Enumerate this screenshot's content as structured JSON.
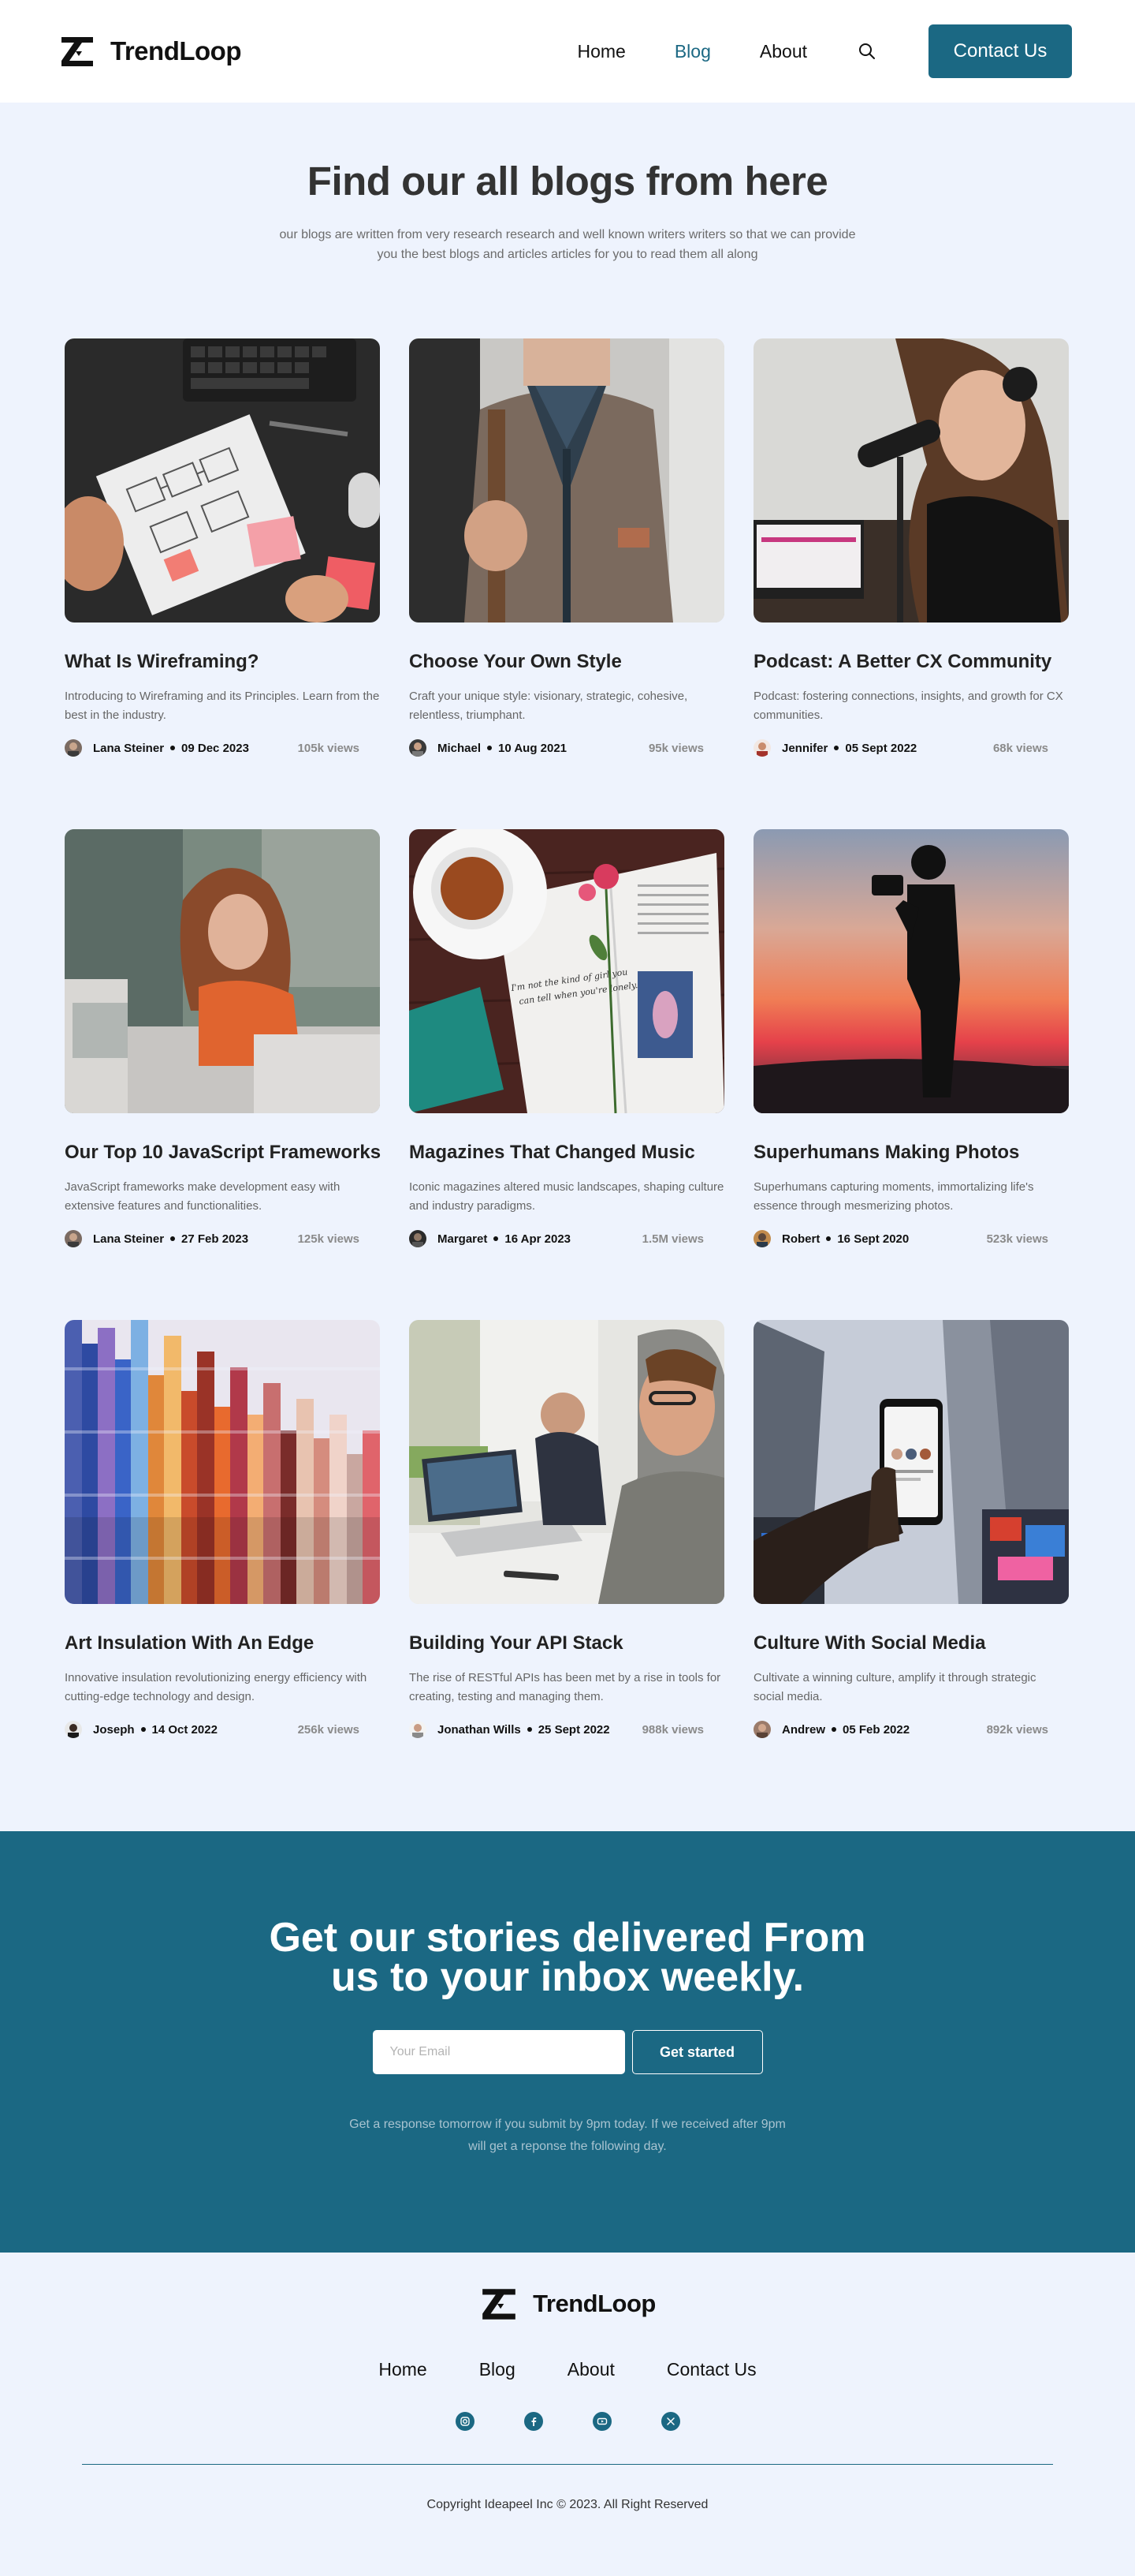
{
  "header": {
    "brand": "TrendLoop",
    "nav": [
      "Home",
      "Blog",
      "About"
    ],
    "active_nav": "Blog",
    "search_icon": "search-icon",
    "contact_label": "Contact Us"
  },
  "hero": {
    "title": "Find our all blogs from here",
    "subtitle": "our blogs are written from very research research and well known writers writers so that  we can provide you the best blogs and articles articles for you to read them all along"
  },
  "posts": [
    {
      "title": "What Is Wireframing?",
      "desc": "Introducing to Wireframing and its Principles. Learn from the best in the industry.",
      "author": "Lana Steiner",
      "date": "09 Dec 2023",
      "views": "105k views"
    },
    {
      "title": "Choose Your Own Style",
      "desc": "Craft your unique style: visionary, strategic, cohesive, relentless, triumphant.",
      "author": "Michael",
      "date": "10 Aug 2021",
      "views": "95k views"
    },
    {
      "title": "Podcast: A Better CX Community",
      "desc": "Podcast: fostering connections, insights, and growth for CX communities.",
      "author": "Jennifer",
      "date": "05 Sept 2022",
      "views": "68k views"
    },
    {
      "title": "Our Top 10 JavaScript Frameworks",
      "desc": "JavaScript frameworks make development easy with extensive features and functionalities.",
      "author": "Lana Steiner",
      "date": "27 Feb 2023",
      "views": "125k views"
    },
    {
      "title": "Magazines That Changed Music",
      "desc": "Iconic magazines altered music landscapes, shaping culture and industry paradigms.",
      "author": "Margaret",
      "date": "16 Apr 2023",
      "views": "1.5M views"
    },
    {
      "title": "Superhumans Making Photos",
      "desc": "Superhumans capturing moments, immortalizing life's essence through mesmerizing photos.",
      "author": "Robert",
      "date": "16 Sept 2020",
      "views": "523k views"
    },
    {
      "title": "Art Insulation With An Edge",
      "desc": "Innovative insulation revolutionizing energy efficiency with cutting-edge technology and design.",
      "author": "Joseph",
      "date": "14 Oct 2022",
      "views": "256k views"
    },
    {
      "title": "Building Your API Stack",
      "desc": "The rise of RESTful APIs has been met by a rise in tools for creating, testing and managing them.",
      "author": "Jonathan Wills",
      "date": "25 Sept 2022",
      "views": "988k views"
    },
    {
      "title": "Culture With Social Media",
      "desc": "Cultivate a winning culture, amplify it through strategic social media.",
      "author": "Andrew",
      "date": "05 Feb 2022",
      "views": "892k views"
    }
  ],
  "newsletter": {
    "title": "Get our stories delivered From us to your inbox weekly.",
    "email_placeholder": "Your Email",
    "button_label": "Get started",
    "note": "Get a response tomorrow if you submit by 9pm today. If we received after 9pm will get a reponse the following day."
  },
  "footer": {
    "brand": "TrendLoop",
    "nav": [
      "Home",
      "Blog",
      "About",
      "Contact Us"
    ],
    "socials": [
      "instagram-icon",
      "facebook-icon",
      "youtube-icon",
      "x-icon"
    ],
    "copyright": "Copyright Ideapeel Inc © 2023. All Right Reserved"
  },
  "colors": {
    "accent": "#1b6883",
    "page_bg": "#eef3fd",
    "header_bg": "#ffffff"
  }
}
